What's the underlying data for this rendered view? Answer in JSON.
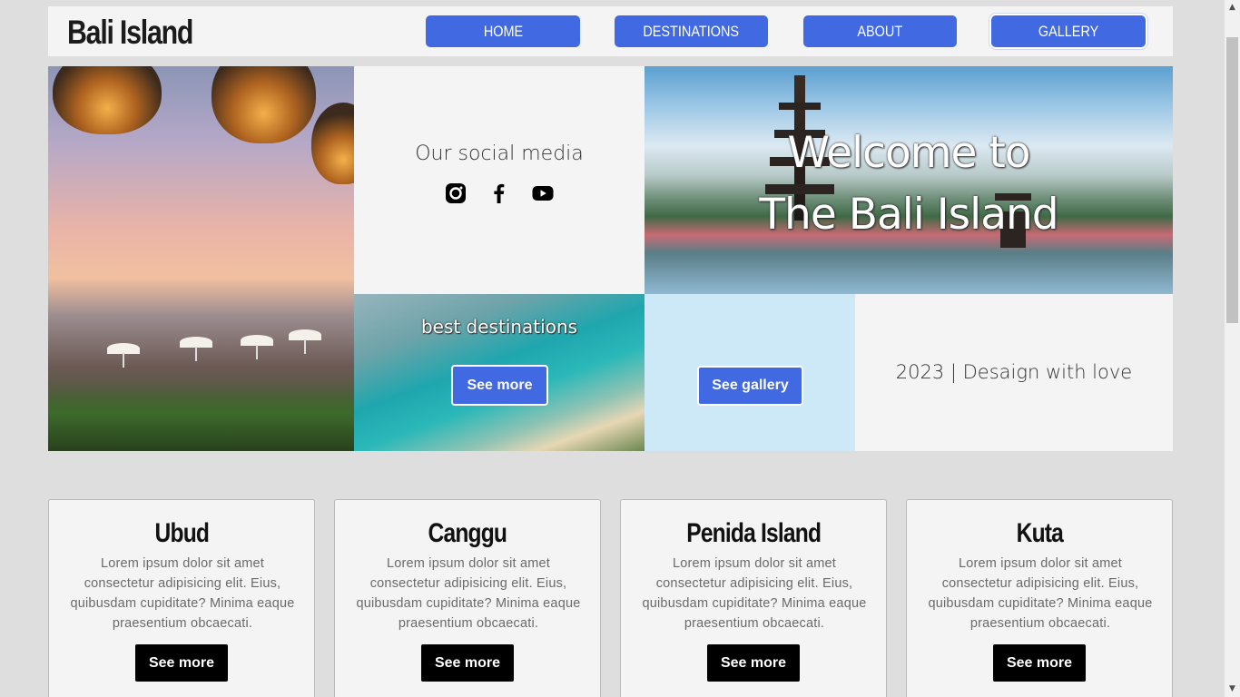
{
  "header": {
    "brand": "Bali Island",
    "nav": [
      "HOME",
      "DESTINATIONS",
      "ABOUT",
      "GALLERY"
    ]
  },
  "hero": {
    "social_title": "Our social media",
    "social_icons": [
      "instagram-icon",
      "facebook-icon",
      "youtube-icon"
    ],
    "welcome_line1": "Welcome to",
    "welcome_line2": "The Bali Island",
    "destinations_title": "best destinations",
    "destinations_button": "See more",
    "gallery_button": "See gallery",
    "footer_note": "2023 | Desaign with love"
  },
  "cards": [
    {
      "title": "Ubud",
      "text": "Lorem ipsum dolor sit amet consectetur adipisicing elit. Eius, quibusdam cupiditate? Minima eaque praesentium obcaecati.",
      "button": "See more"
    },
    {
      "title": "Canggu",
      "text": "Lorem ipsum dolor sit amet consectetur adipisicing elit. Eius, quibusdam cupiditate? Minima eaque praesentium obcaecati.",
      "button": "See more"
    },
    {
      "title": "Penida Island",
      "text": "Lorem ipsum dolor sit amet consectetur adipisicing elit. Eius, quibusdam cupiditate? Minima eaque praesentium obcaecati.",
      "button": "See more"
    },
    {
      "title": "Kuta",
      "text": "Lorem ipsum dolor sit amet consectetur adipisicing elit. Eius, quibusdam cupiditate? Minima eaque praesentium obcaecati.",
      "button": "See more"
    }
  ],
  "colors": {
    "accent": "#4169e1",
    "page_background": "#dedede",
    "panel": "#f4f4f4",
    "gallery_panel": "#cde9f8"
  }
}
